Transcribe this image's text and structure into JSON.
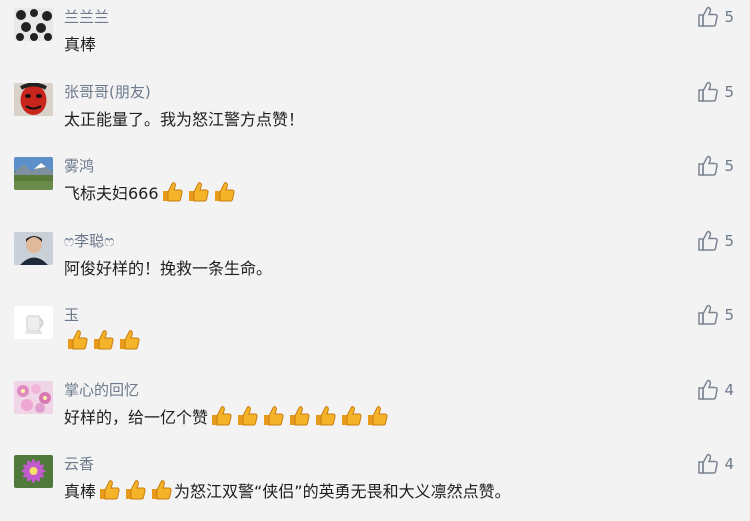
{
  "comments": [
    {
      "name": "兰兰兰",
      "parts": [
        "真棒"
      ],
      "likes": "5",
      "avatar": "black-white-dotted-avatar"
    },
    {
      "name": "张哥哥(朋友)",
      "parts": [
        "太正能量了。我为怒江警方点赞！"
      ],
      "likes": "5",
      "avatar": "red-mask-avatar"
    },
    {
      "name": "雾鸿",
      "parts": [
        "飞标夫妇666",
        "[thumbs-up]",
        "[thumbs-up]",
        "[thumbs-up]"
      ],
      "likes": "5",
      "avatar": "landscape-avatar"
    },
    {
      "name": "ෆ李聪ෆ",
      "parts": [
        "阿俊好样的！挽救一条生命。"
      ],
      "likes": "5",
      "avatar": "person-photo-avatar"
    },
    {
      "name": "玉",
      "parts": [
        "[thumbs-up]",
        "[thumbs-up]",
        "[thumbs-up]"
      ],
      "likes": "5",
      "avatar": "white-cup-avatar"
    },
    {
      "name": "掌心的回忆",
      "parts": [
        "好样的，给一亿个赞",
        "[thumbs-up]",
        "[thumbs-up]",
        "[thumbs-up]",
        "[thumbs-up]",
        "[thumbs-up]",
        "[thumbs-up]",
        "[thumbs-up]"
      ],
      "likes": "4",
      "avatar": "pink-flowers-avatar"
    },
    {
      "name": "云香",
      "parts": [
        "真棒",
        "[thumbs-up]",
        "[thumbs-up]",
        "[thumbs-up]",
        "为怒江双警“侠侣”的英勇无畏和大义凛然点赞。"
      ],
      "likes": "4",
      "avatar": "purple-flower-avatar"
    }
  ],
  "icons": {
    "like": "thumbs-up-outline-icon",
    "emoji": "thumbs-up-emoji"
  },
  "colors": {
    "background": "#f3f3f3",
    "name": "#6d7a8c",
    "text": "#1f1f1f",
    "emoji": "#f5b32a"
  }
}
